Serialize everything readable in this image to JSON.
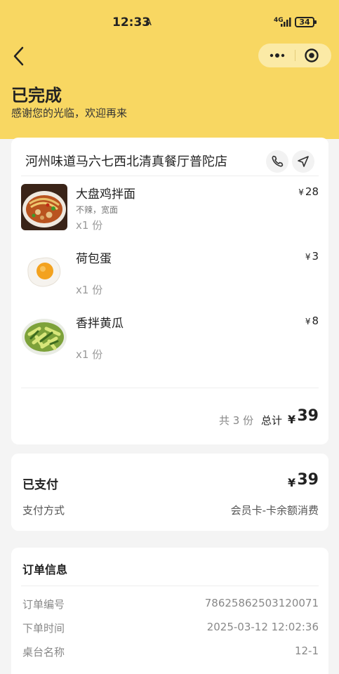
{
  "status_bar": {
    "time": "12:33",
    "time_extra": "A",
    "signal": "4G",
    "battery": "34"
  },
  "header": {
    "title": "已完成",
    "subtitle": "感谢您的光临，欢迎再来"
  },
  "store": {
    "name": "河州味道马六七西北清真餐厅普陀店"
  },
  "items": [
    {
      "name": "大盘鸡拌面",
      "spec": "不辣，宽面",
      "qty": "x1 份",
      "currency": "¥",
      "price": "28"
    },
    {
      "name": "荷包蛋",
      "spec": "",
      "qty": "x1 份",
      "currency": "¥",
      "price": "3"
    },
    {
      "name": "香拌黄瓜",
      "spec": "",
      "qty": "x1 份",
      "currency": "¥",
      "price": "8"
    }
  ],
  "summary": {
    "count": "共 3 份",
    "total_label": "总计",
    "currency": "¥",
    "total": "39"
  },
  "payment": {
    "paid_label": "已支付",
    "currency": "¥",
    "paid_amount": "39",
    "method_label": "支付方式",
    "method_value": "会员卡-卡余额消费"
  },
  "order_info": {
    "title": "订单信息",
    "rows": [
      {
        "label": "订单编号",
        "value": "78625862503120071"
      },
      {
        "label": "下单时间",
        "value": "2025-03-12 12:02:36"
      },
      {
        "label": "桌台名称",
        "value": "12-1"
      }
    ]
  },
  "icons": [
    "back-arrow-icon",
    "more-dots-icon",
    "close-target-icon",
    "phone-icon",
    "navigation-icon"
  ],
  "colors": {
    "header_bg": "#f8d762",
    "capsule_bg": "#fbeaa6",
    "page_bg": "#f4f4f4"
  }
}
